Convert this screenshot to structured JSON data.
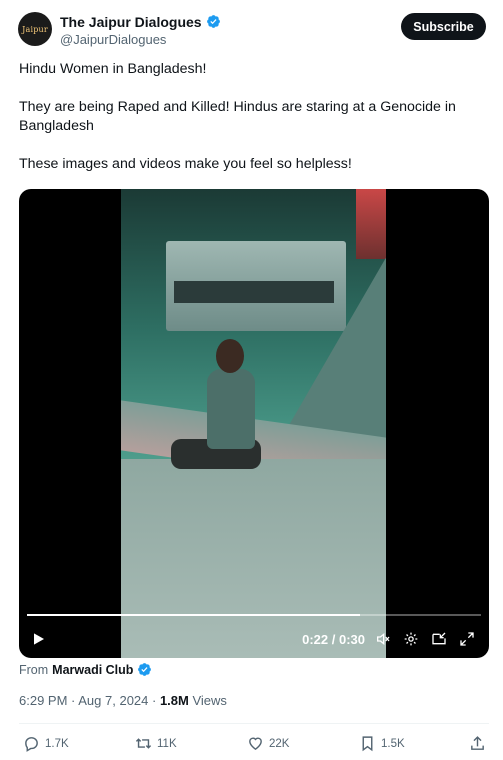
{
  "author": {
    "display_name": "The Jaipur Dialogues",
    "handle": "@JaipurDialogues",
    "avatar_text": "Jaipur"
  },
  "header": {
    "subscribe_label": "Subscribe"
  },
  "tweet": {
    "paragraphs": [
      "Hindu Women in Bangladesh!",
      "They are being Raped and Killed! Hindus are staring at a Genocide in Bangladesh",
      "These images and videos make you feel so helpless!"
    ]
  },
  "video": {
    "elapsed": "0:22",
    "duration": "0:30",
    "time_display": "0:22 / 0:30",
    "progress_fraction": 0.733
  },
  "source": {
    "prefix": "From",
    "name": "Marwadi Club"
  },
  "meta": {
    "time": "6:29 PM",
    "separator": " · ",
    "date": "Aug 7, 2024",
    "views_count": "1.8M",
    "views_label": "Views"
  },
  "actions": {
    "replies": "1.7K",
    "reposts": "11K",
    "likes": "22K",
    "bookmarks": "1.5K"
  },
  "colors": {
    "verified": "#1d9bf0",
    "text": "#0f1419",
    "muted": "#536471",
    "accent_button": "#0f1419"
  }
}
